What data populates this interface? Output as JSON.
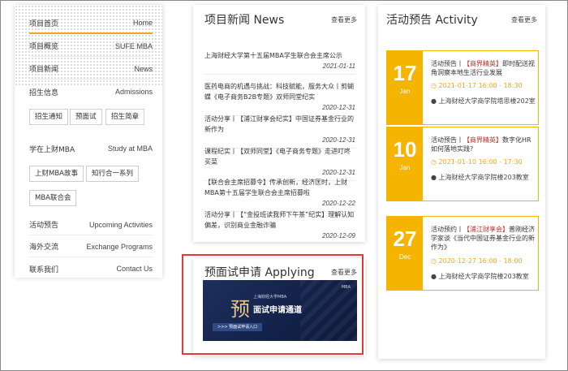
{
  "leftnav": {
    "rows": [
      {
        "cn": "项目首页",
        "en": "Home"
      },
      {
        "cn": "项目概览",
        "en": "SUFE MBA"
      },
      {
        "cn": "项目新闻",
        "en": "News"
      },
      {
        "cn": "招生信息",
        "en": "Admissions"
      }
    ],
    "admissions_tags": [
      "招生通知",
      "预面试",
      "招生简章"
    ],
    "study_row": {
      "cn": "学在上财MBA",
      "en": "Study at MBA"
    },
    "study_tags": [
      "上财MBA故事",
      "知行合一系列",
      "MBA联合会"
    ],
    "bottom_rows": [
      {
        "cn": "活动预告",
        "en": "Upcoming Activities"
      },
      {
        "cn": "海外交流",
        "en": "Exchange Programs"
      },
      {
        "cn": "联系我们",
        "en": "Contact Us"
      }
    ]
  },
  "news": {
    "title": "项目新闻 News",
    "more": "查看更多",
    "items": [
      {
        "text": "上海财经大学第十五届MBA学生联合会主席公示",
        "date": "2021-01-11"
      },
      {
        "text": "医药电商的机遇与挑战：科技赋能，服务大众丨剪蝴蝶《电子商务B2B专题》双师同堂纪实",
        "date": "2020-12-31"
      },
      {
        "text": "活动分享丨【浦江财享会纪实】中国证券基金行业的新作为",
        "date": "2020-12-31"
      },
      {
        "text": "课程纪实丨【双师同堂】《电子商务专题》走进叮咚买菜",
        "date": "2020-12-31"
      },
      {
        "text": "【联合会主席招募令】传承创新，经济匡时，上财MBA第十五届学生联合会主席招募啦",
        "date": "2020-12-22"
      },
      {
        "text": "活动分享丨【“金投班读我师下午茶”纪实】理解认知偏差，识别商业金融诈骗",
        "date": "2020-12-09"
      }
    ]
  },
  "apply": {
    "title": "预面试申请 Applying",
    "more": "查看更多",
    "banner": {
      "char": "预",
      "small": "上海财经大学MBA",
      "big": "面试申请通道",
      "button": ">>> 预面试申请入口",
      "logo": "MBA"
    }
  },
  "activity": {
    "title": "活动预告 Activity",
    "more": "查看更多",
    "items": [
      {
        "day": "17",
        "month": "Jan",
        "prefix": "活动预告丨",
        "highlight": "【商界精英】",
        "rest": "即时配送视角洞察本地生活行业发展",
        "time": "2021-01-17 16:00 - 18:30",
        "place": "上海财经大学商学院塔思楼202室"
      },
      {
        "day": "10",
        "month": "Jan",
        "prefix": "活动预告丨",
        "highlight": "【商界精英】",
        "rest": "数字化HR如何落地实践?",
        "time": "2021-01-10 16:00 - 17:30",
        "place": "上海财经大学商学院楼203教室"
      },
      {
        "day": "27",
        "month": "Dec",
        "prefix": "活动预约丨",
        "highlight": "【浦江财享会】",
        "rest": "普刚经济学家谈《当代中国证券基金行业的新作为》",
        "time": "2020-12-27 16:00 - 18:00",
        "place": "上海财经大学商学院楼203教室"
      }
    ]
  }
}
